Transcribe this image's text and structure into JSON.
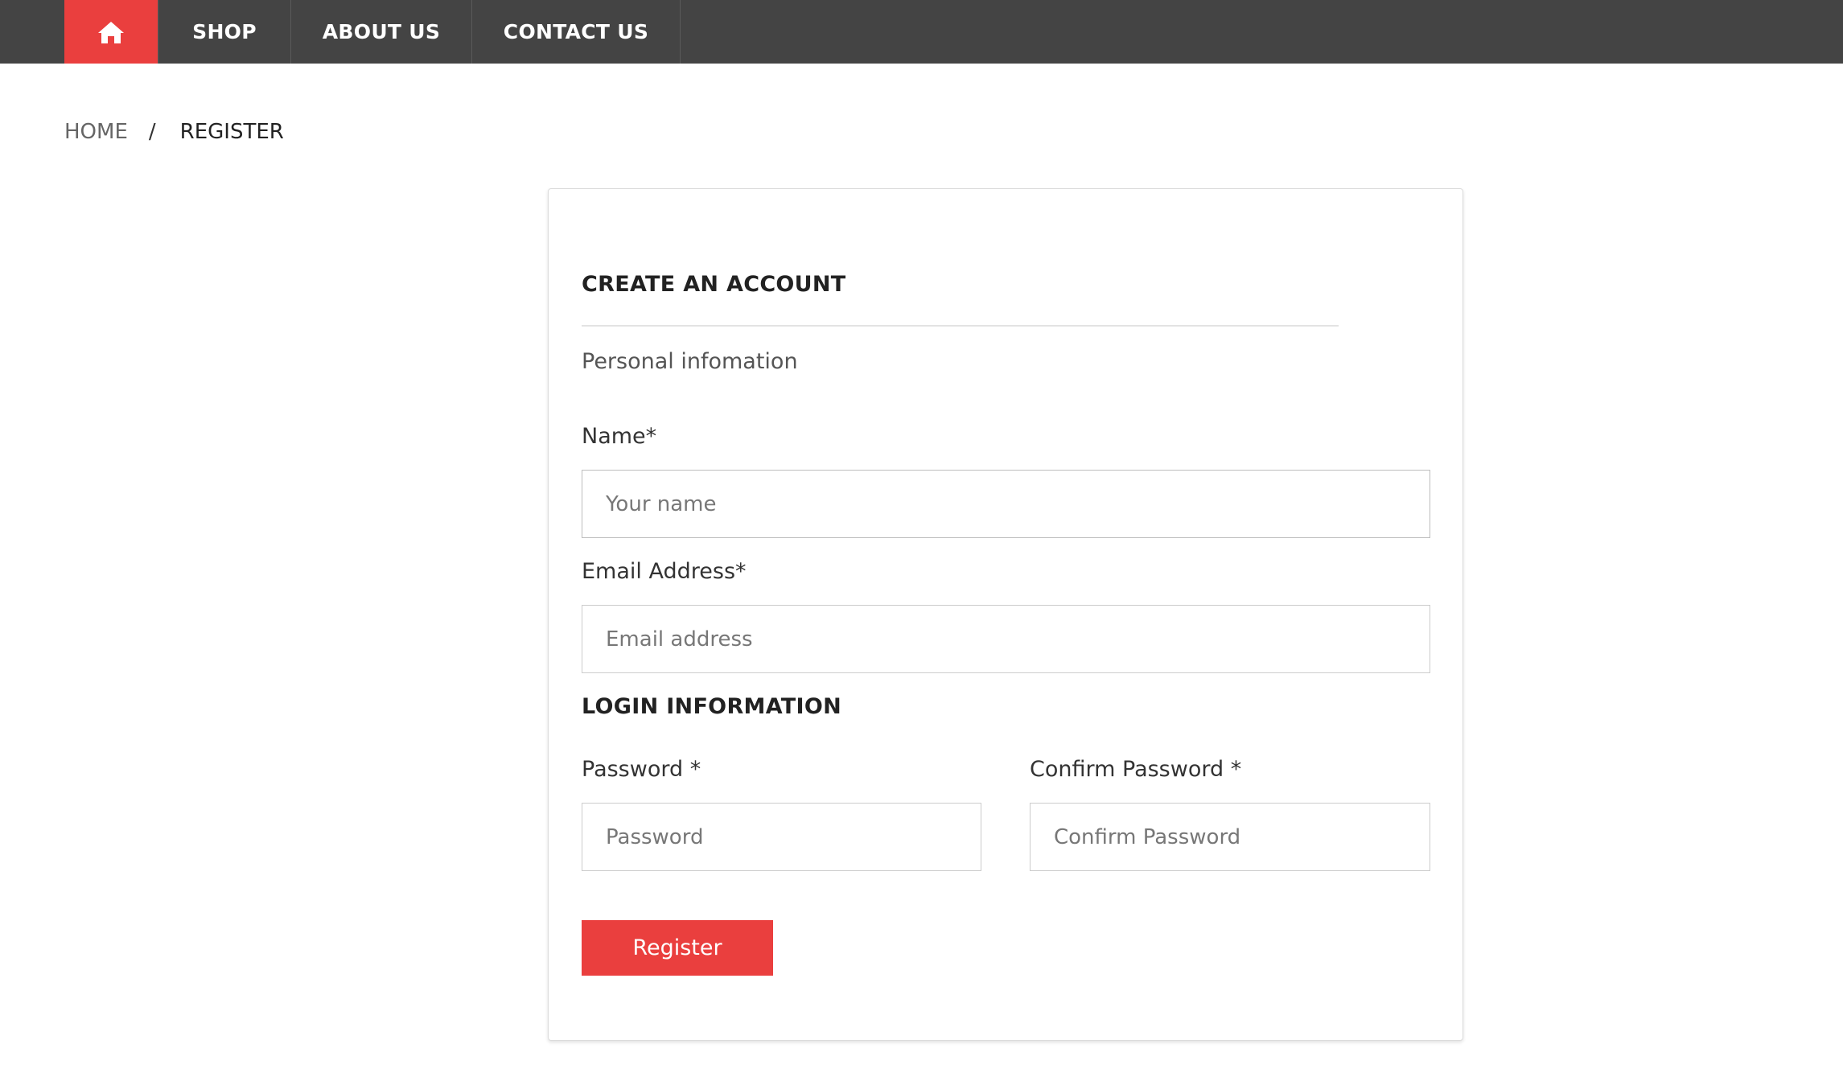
{
  "nav": {
    "home_icon": "home-icon",
    "items": [
      {
        "label": "SHOP"
      },
      {
        "label": "ABOUT US"
      },
      {
        "label": "CONTACT US"
      }
    ],
    "accent_color": "#ea3f3e",
    "bar_color": "#444444"
  },
  "breadcrumb": {
    "home": "HOME",
    "separator": "/",
    "current": "REGISTER"
  },
  "form": {
    "title": "CREATE AN ACCOUNT",
    "section_personal": "Personal infomation",
    "name": {
      "label": "Name*",
      "placeholder": "Your name",
      "value": ""
    },
    "email": {
      "label": "Email Address*",
      "placeholder": "Email address",
      "value": ""
    },
    "section_login": "LOGIN INFORMATION",
    "password": {
      "label": "Password *",
      "placeholder": "Password",
      "value": ""
    },
    "confirm_password": {
      "label": "Confirm Password *",
      "placeholder": "Confirm Password",
      "value": ""
    },
    "submit_label": "Register"
  }
}
